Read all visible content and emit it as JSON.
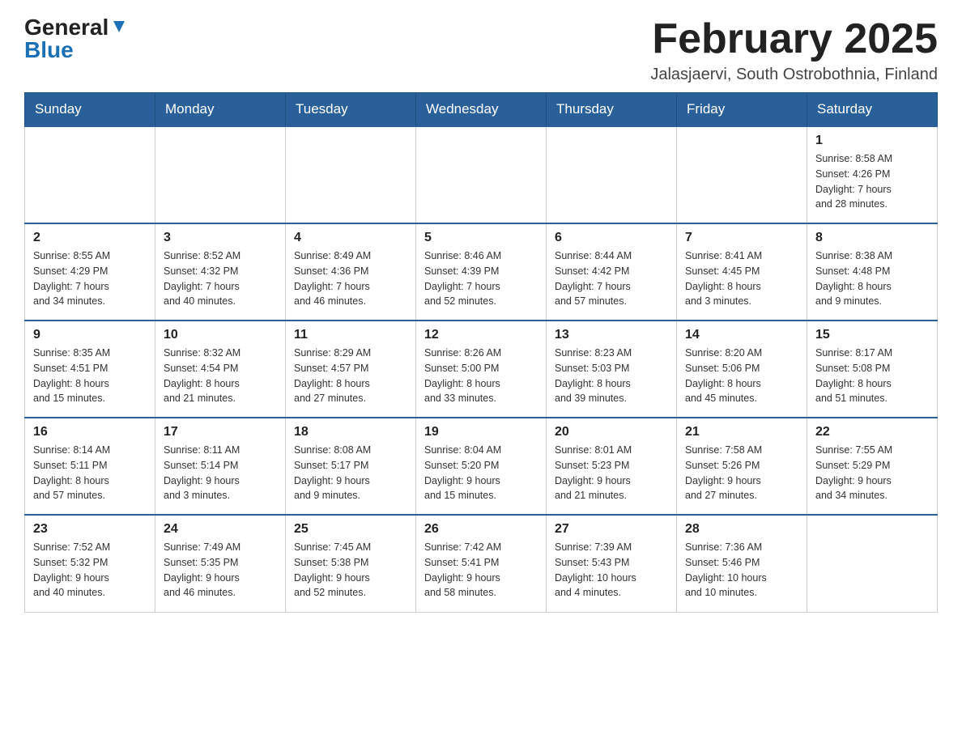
{
  "header": {
    "logo_general": "General",
    "logo_blue": "Blue",
    "month_title": "February 2025",
    "location": "Jalasjaervi, South Ostrobothnia, Finland"
  },
  "weekdays": [
    "Sunday",
    "Monday",
    "Tuesday",
    "Wednesday",
    "Thursday",
    "Friday",
    "Saturday"
  ],
  "weeks": [
    {
      "days": [
        {
          "number": "",
          "info": ""
        },
        {
          "number": "",
          "info": ""
        },
        {
          "number": "",
          "info": ""
        },
        {
          "number": "",
          "info": ""
        },
        {
          "number": "",
          "info": ""
        },
        {
          "number": "",
          "info": ""
        },
        {
          "number": "1",
          "info": "Sunrise: 8:58 AM\nSunset: 4:26 PM\nDaylight: 7 hours\nand 28 minutes."
        }
      ]
    },
    {
      "days": [
        {
          "number": "2",
          "info": "Sunrise: 8:55 AM\nSunset: 4:29 PM\nDaylight: 7 hours\nand 34 minutes."
        },
        {
          "number": "3",
          "info": "Sunrise: 8:52 AM\nSunset: 4:32 PM\nDaylight: 7 hours\nand 40 minutes."
        },
        {
          "number": "4",
          "info": "Sunrise: 8:49 AM\nSunset: 4:36 PM\nDaylight: 7 hours\nand 46 minutes."
        },
        {
          "number": "5",
          "info": "Sunrise: 8:46 AM\nSunset: 4:39 PM\nDaylight: 7 hours\nand 52 minutes."
        },
        {
          "number": "6",
          "info": "Sunrise: 8:44 AM\nSunset: 4:42 PM\nDaylight: 7 hours\nand 57 minutes."
        },
        {
          "number": "7",
          "info": "Sunrise: 8:41 AM\nSunset: 4:45 PM\nDaylight: 8 hours\nand 3 minutes."
        },
        {
          "number": "8",
          "info": "Sunrise: 8:38 AM\nSunset: 4:48 PM\nDaylight: 8 hours\nand 9 minutes."
        }
      ]
    },
    {
      "days": [
        {
          "number": "9",
          "info": "Sunrise: 8:35 AM\nSunset: 4:51 PM\nDaylight: 8 hours\nand 15 minutes."
        },
        {
          "number": "10",
          "info": "Sunrise: 8:32 AM\nSunset: 4:54 PM\nDaylight: 8 hours\nand 21 minutes."
        },
        {
          "number": "11",
          "info": "Sunrise: 8:29 AM\nSunset: 4:57 PM\nDaylight: 8 hours\nand 27 minutes."
        },
        {
          "number": "12",
          "info": "Sunrise: 8:26 AM\nSunset: 5:00 PM\nDaylight: 8 hours\nand 33 minutes."
        },
        {
          "number": "13",
          "info": "Sunrise: 8:23 AM\nSunset: 5:03 PM\nDaylight: 8 hours\nand 39 minutes."
        },
        {
          "number": "14",
          "info": "Sunrise: 8:20 AM\nSunset: 5:06 PM\nDaylight: 8 hours\nand 45 minutes."
        },
        {
          "number": "15",
          "info": "Sunrise: 8:17 AM\nSunset: 5:08 PM\nDaylight: 8 hours\nand 51 minutes."
        }
      ]
    },
    {
      "days": [
        {
          "number": "16",
          "info": "Sunrise: 8:14 AM\nSunset: 5:11 PM\nDaylight: 8 hours\nand 57 minutes."
        },
        {
          "number": "17",
          "info": "Sunrise: 8:11 AM\nSunset: 5:14 PM\nDaylight: 9 hours\nand 3 minutes."
        },
        {
          "number": "18",
          "info": "Sunrise: 8:08 AM\nSunset: 5:17 PM\nDaylight: 9 hours\nand 9 minutes."
        },
        {
          "number": "19",
          "info": "Sunrise: 8:04 AM\nSunset: 5:20 PM\nDaylight: 9 hours\nand 15 minutes."
        },
        {
          "number": "20",
          "info": "Sunrise: 8:01 AM\nSunset: 5:23 PM\nDaylight: 9 hours\nand 21 minutes."
        },
        {
          "number": "21",
          "info": "Sunrise: 7:58 AM\nSunset: 5:26 PM\nDaylight: 9 hours\nand 27 minutes."
        },
        {
          "number": "22",
          "info": "Sunrise: 7:55 AM\nSunset: 5:29 PM\nDaylight: 9 hours\nand 34 minutes."
        }
      ]
    },
    {
      "days": [
        {
          "number": "23",
          "info": "Sunrise: 7:52 AM\nSunset: 5:32 PM\nDaylight: 9 hours\nand 40 minutes."
        },
        {
          "number": "24",
          "info": "Sunrise: 7:49 AM\nSunset: 5:35 PM\nDaylight: 9 hours\nand 46 minutes."
        },
        {
          "number": "25",
          "info": "Sunrise: 7:45 AM\nSunset: 5:38 PM\nDaylight: 9 hours\nand 52 minutes."
        },
        {
          "number": "26",
          "info": "Sunrise: 7:42 AM\nSunset: 5:41 PM\nDaylight: 9 hours\nand 58 minutes."
        },
        {
          "number": "27",
          "info": "Sunrise: 7:39 AM\nSunset: 5:43 PM\nDaylight: 10 hours\nand 4 minutes."
        },
        {
          "number": "28",
          "info": "Sunrise: 7:36 AM\nSunset: 5:46 PM\nDaylight: 10 hours\nand 10 minutes."
        },
        {
          "number": "",
          "info": ""
        }
      ]
    }
  ]
}
